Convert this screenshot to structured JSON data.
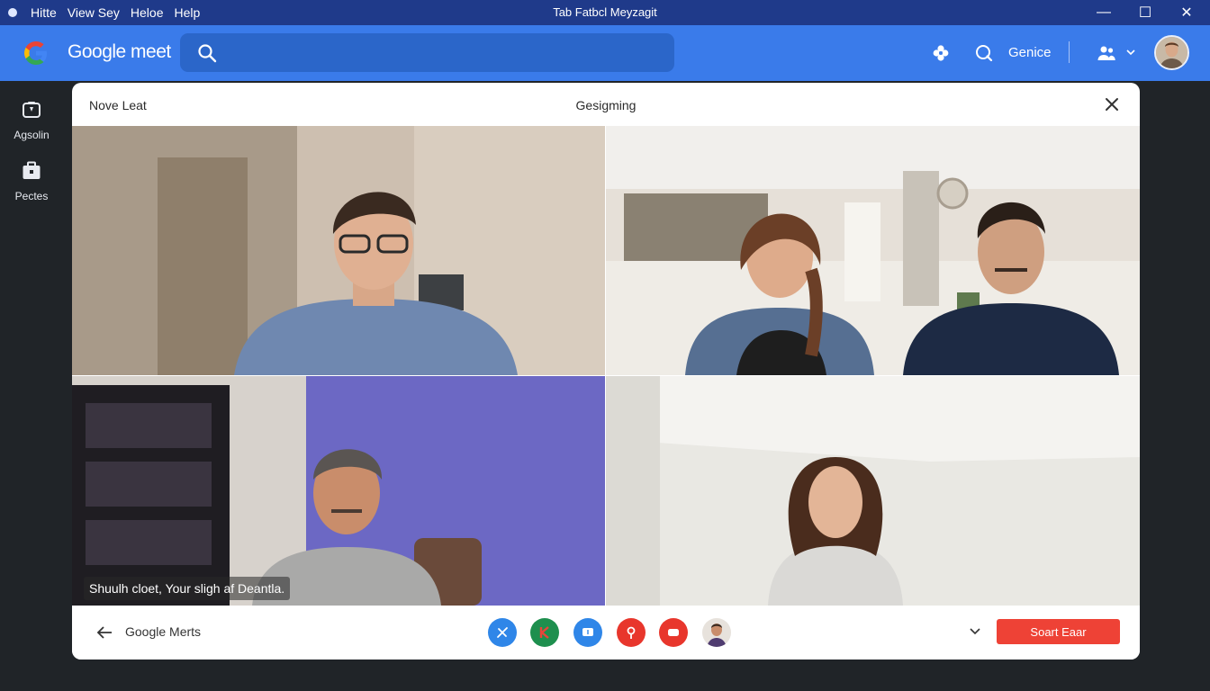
{
  "window": {
    "menu": [
      "Hitte",
      "View Sey",
      "Heloe",
      "Help"
    ],
    "title": "Tab Fatbcl Meyzagit",
    "controls": {
      "minimize": "—",
      "maximize": "☐",
      "close": "✕"
    }
  },
  "header": {
    "brand": "Google meet",
    "search": {
      "placeholder": ""
    },
    "label": "Genice"
  },
  "rail": {
    "items": [
      {
        "label": "Agsolin",
        "icon": "camera-icon"
      },
      {
        "label": "Pectes",
        "icon": "briefcase-icon"
      }
    ]
  },
  "meeting": {
    "left_title": "Nove Leat",
    "center_title": "Gesigming",
    "caption": "Shuulh cloet, Your sligh af Deantla.",
    "back_label": "Google Merts",
    "controls": [
      {
        "icon": "mic-off-icon",
        "color": "#2f86e8"
      },
      {
        "icon": "k-app-icon",
        "color": "#1e8f4e"
      },
      {
        "icon": "chat-icon",
        "color": "#2f86e8"
      },
      {
        "icon": "pin-icon",
        "color": "#e8362c"
      },
      {
        "icon": "video-icon",
        "color": "#e8362c"
      },
      {
        "icon": "participant-avatar-icon",
        "color": "#c9a58a"
      }
    ],
    "start_button": "Soart Eaar"
  },
  "colors": {
    "title_bar": "#1f3a8a",
    "header": "#3a7bea",
    "search": "#2b66c9",
    "background": "#202428",
    "primary_button": "#ee4236"
  }
}
